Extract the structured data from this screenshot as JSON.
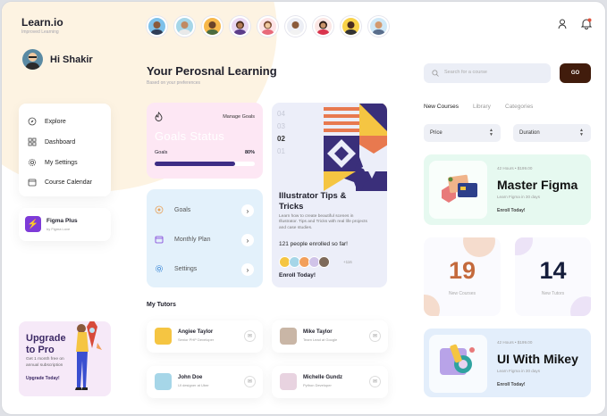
{
  "app": {
    "logo": "Learn.io",
    "tagline": "Improved Learning"
  },
  "user": {
    "greeting": "Hi Shakir"
  },
  "sidebar": {
    "items": [
      {
        "label": "Explore",
        "icon": "compass-icon"
      },
      {
        "label": "Dashboard",
        "icon": "grid-icon"
      },
      {
        "label": "My Settings",
        "icon": "gear-icon"
      },
      {
        "label": "Course Calendar",
        "icon": "calendar-icon"
      }
    ],
    "plan": {
      "title": "Figma Plus",
      "subtitle": "by Figma Love"
    },
    "upgrade": {
      "title": "Upgrade to Pro",
      "text": "Get 1 month free on annual subscription",
      "link": "Upgrade Today!"
    }
  },
  "tutors_strip": {
    "count": 9
  },
  "main": {
    "title": "Your Perosnal Learning",
    "subtitle": "Based on your preferences",
    "goals": {
      "manage": "Manage Goals",
      "title": "Goals Status",
      "label": "Goals",
      "percent": "80%",
      "progress": 0.8
    },
    "stats": [
      {
        "label": "Goals"
      },
      {
        "label": "Monthly Plan"
      },
      {
        "label": "Settings"
      }
    ],
    "featured": {
      "steps": [
        "04",
        "03",
        "02",
        "01"
      ],
      "active": "02",
      "title": "Illustrator Tips & Tricks",
      "desc": "Learn how to create beautiful scenes in Illustrator. Tips and Tricks with real life projects and case studies.",
      "enrolled": "121 people enrolled so far!",
      "more": "+116",
      "cta": "Enroll Today!"
    },
    "tutors_heading": "My Tutors",
    "tutors": [
      {
        "name": "Angiee Taylor",
        "role": "Senior PHP Developer"
      },
      {
        "name": "Mike Taylor",
        "role": "Team Lead at Google"
      },
      {
        "name": "John Doe",
        "role": "UI designer at Uber"
      },
      {
        "name": "Michelle Gundz",
        "role": "Python Developer"
      }
    ]
  },
  "right": {
    "search_placeholder": "Search for a course",
    "go": "GO",
    "tabs": [
      "New Courses",
      "Library",
      "Categories"
    ],
    "filters": [
      "Price",
      "Duration"
    ],
    "course1": {
      "meta": "42 Hours  •  $199.00",
      "title": "Master Figma",
      "sub": "Learn Figma in 30 days",
      "cta": "Enroll Today!"
    },
    "stat1": {
      "value": "19",
      "label": "New Courses"
    },
    "stat2": {
      "value": "14",
      "label": "New Tutors"
    },
    "course2": {
      "meta": "42 Hours  •  $199.00",
      "title": "UI With Mikey",
      "sub": "Learn Figma in 30 days",
      "cta": "Enroll Today!"
    }
  },
  "colors": {
    "accent": "#411c0c",
    "purple": "#7e3bd8",
    "progress": "#3d2d85"
  }
}
